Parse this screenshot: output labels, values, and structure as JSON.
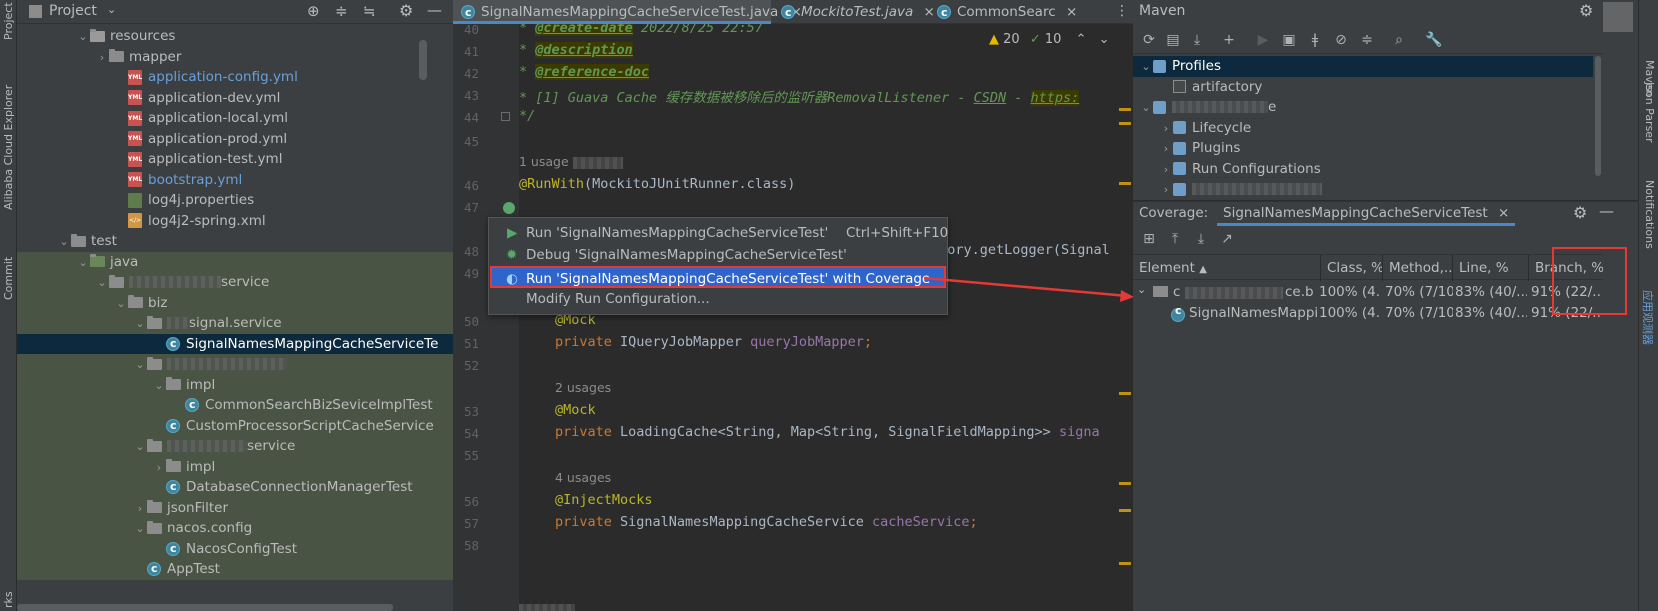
{
  "left_stripe": {
    "project": "Project",
    "alibaba": "Alibaba Cloud Explorer",
    "commit": "Commit",
    "bookmarks": "rks"
  },
  "project": {
    "title": "Project",
    "tree": [
      {
        "label": "resources",
        "type": "folder-res",
        "indent": 5,
        "arrow": "v"
      },
      {
        "label": "mapper",
        "type": "folder",
        "indent": 6,
        "arrow": ">"
      },
      {
        "label": "application-config.yml",
        "type": "yml",
        "indent": 7,
        "color": "#6a9fd8"
      },
      {
        "label": "application-dev.yml",
        "type": "yml",
        "indent": 7
      },
      {
        "label": "application-local.yml",
        "type": "yml",
        "indent": 7
      },
      {
        "label": "application-prod.yml",
        "type": "yml",
        "indent": 7
      },
      {
        "label": "application-test.yml",
        "type": "yml",
        "indent": 7
      },
      {
        "label": "bootstrap.yml",
        "type": "yml",
        "indent": 7,
        "color": "#6a9fd8"
      },
      {
        "label": "log4j.properties",
        "type": "prop",
        "indent": 7
      },
      {
        "label": "log4j2-spring.xml",
        "type": "xml",
        "indent": 7
      },
      {
        "label": "test",
        "type": "folder",
        "indent": 4,
        "arrow": "v"
      },
      {
        "label": "java",
        "type": "folder-green",
        "indent": 5,
        "arrow": "v",
        "green": true
      },
      {
        "label": "service",
        "type": "folder",
        "indent": 6,
        "arrow": "v",
        "green": true,
        "blur": 92
      },
      {
        "label": "biz",
        "type": "folder",
        "indent": 7,
        "arrow": "v",
        "green": true
      },
      {
        "label": "signal.service",
        "type": "folder",
        "indent": 8,
        "arrow": "v",
        "green": true,
        "blur": 22
      },
      {
        "label": "SignalNamesMappingCacheServiceTe",
        "type": "class",
        "indent": 9,
        "selected": true
      },
      {
        "label": "",
        "type": "folder",
        "indent": 8,
        "arrow": "v",
        "green": true,
        "blur": 120
      },
      {
        "label": "impl",
        "type": "folder",
        "indent": 9,
        "arrow": "v",
        "green": true
      },
      {
        "label": "CommonSearchBizSeviceImplTest",
        "type": "class",
        "indent": 10,
        "green": true
      },
      {
        "label": "CustomProcessorScriptCacheService",
        "type": "class",
        "indent": 9,
        "green": true
      },
      {
        "label": "service",
        "type": "folder",
        "indent": 8,
        "arrow": "v",
        "green": true,
        "blur": 80
      },
      {
        "label": "impl",
        "type": "folder",
        "indent": 9,
        "arrow": ">",
        "green": true
      },
      {
        "label": "DatabaseConnectionManagerTest",
        "type": "class",
        "indent": 9,
        "green": true
      },
      {
        "label": "jsonFilter",
        "type": "folder",
        "indent": 8,
        "arrow": ">",
        "green": true
      },
      {
        "label": "nacos.config",
        "type": "folder",
        "indent": 8,
        "arrow": "v",
        "green": true
      },
      {
        "label": "NacosConfigTest",
        "type": "class",
        "indent": 9,
        "green": true
      },
      {
        "label": "AppTest",
        "type": "class",
        "indent": 8,
        "green": true
      }
    ]
  },
  "editor": {
    "tabs": [
      {
        "label": "SignalNamesMappingCacheServiceTest.java",
        "active": true
      },
      {
        "label": "MockitoTest.java",
        "italic": true
      },
      {
        "label": "CommonSearc"
      }
    ],
    "warnings": "20",
    "checks": "10",
    "line_numbers": [
      "40",
      "41",
      "42",
      "43",
      "44",
      "45",
      "46",
      "47",
      "48",
      "49",
      "50",
      "51",
      "52",
      "53",
      "54",
      "55",
      "56",
      "57",
      "58"
    ],
    "lines": {
      "l40_tag": "@create-date",
      "l40_text": " 2022/8/25 22:57",
      "l41_tag": "@description",
      "l42_tag": "@reference-doc",
      "l43_text": " *  [1] Guava Cache 缓存数据被移除后的监听器RemovalListener - ",
      "l43_csdn": "CSDN",
      "l43_dash": " - ",
      "l43_https": "https:",
      "l44_text": " */",
      "usage_1": "1 usage",
      "l46_ann": "@RunWith",
      "l46_rest": "(MockitoJUnitRunner.class)",
      "l48_rest": "ctory.getLogger(Signal",
      "l50_ann": "@Mock",
      "l51_kw": "private",
      "l51_type": " IQueryJobMapper ",
      "l51_field": "queryJobMapper",
      "l51_semi": ";",
      "usage_2": "2 usages",
      "l53_ann": "@Mock",
      "l54_kw": "private",
      "l54_type": " LoadingCache<String, Map<String, SignalFieldMapping>> ",
      "l54_field": "signa",
      "usage_4": "4 usages",
      "l56_ann": "@InjectMocks",
      "l57_kw": "private",
      "l57_type": " SignalNamesMappingCacheService ",
      "l57_field": "cacheService",
      "l57_semi": ";"
    }
  },
  "popup": {
    "items": [
      {
        "label": "Run 'SignalNamesMappingCacheServiceTest'",
        "shortcut": "Ctrl+Shift+F10",
        "icon": "run-icon"
      },
      {
        "label": "Debug 'SignalNamesMappingCacheServiceTest'",
        "icon": "debug-icon"
      },
      {
        "label": "Run 'SignalNamesMappingCacheServiceTest' with Coverage",
        "icon": "coverage-icon"
      },
      {
        "label": "Modify Run Configuration...",
        "icon": ""
      }
    ]
  },
  "maven": {
    "title": "Maven",
    "tree": [
      {
        "label": "Profiles",
        "arrow": "v",
        "selected": true
      },
      {
        "label": "artifactory",
        "checkbox": true
      },
      {
        "label": "e",
        "arrow": "v",
        "blur": true
      },
      {
        "label": "Lifecycle",
        "arrow": ">"
      },
      {
        "label": "Plugins",
        "arrow": ">"
      },
      {
        "label": "Run Configurations",
        "arrow": ">"
      },
      {
        "label": "",
        "arrow": ">",
        "blur": true
      }
    ]
  },
  "coverage": {
    "title": "Coverage:",
    "tab": "SignalNamesMappingCacheServiceTest",
    "columns": [
      "Element",
      "Class, %",
      "Method,...",
      "Line, %",
      "Branch, %"
    ],
    "rows": [
      {
        "element": "c",
        "element_suffix": "ce.b",
        "class": "100% (4...",
        "method": "70% (7/10)",
        "line": "83% (40/...",
        "branch": "91% (22/..."
      },
      {
        "element": "SignalNamesMapping",
        "class": "100% (4...",
        "method": "70% (7/10)",
        "line": "83% (40/...",
        "branch": "91% (22/..."
      }
    ]
  },
  "right_stripe": {
    "maven": "Maven",
    "json_parser": "Json Parser",
    "notifications": "Notifications",
    "other": "应用观测器"
  },
  "colors": {
    "accent": "#4a88c7",
    "highlight": "#2f65ca",
    "annotation_red": "#e53935"
  }
}
